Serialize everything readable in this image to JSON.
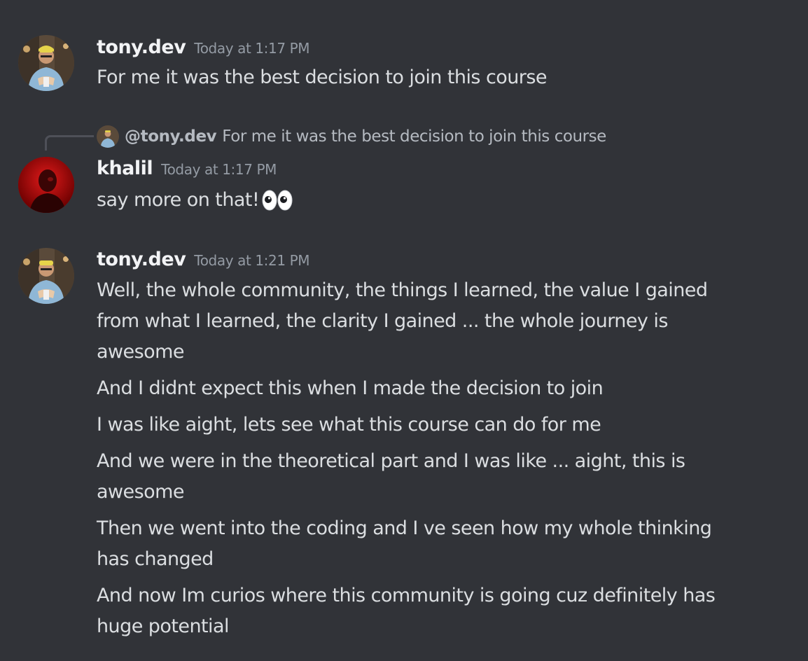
{
  "messages": [
    {
      "username": "tony.dev",
      "timestamp": "Today at 1:17 PM",
      "lines": [
        "For me it was the best decision to join this course"
      ]
    },
    {
      "reply_to": {
        "mention": "@tony.dev",
        "text": "For me it was the best decision to join this course"
      },
      "username": "khalil",
      "timestamp": "Today at 1:17 PM",
      "lines": [
        "say more on that!"
      ],
      "emoji": "eyes"
    },
    {
      "username": "tony.dev",
      "timestamp": "Today at 1:21 PM",
      "lines": [
        "Well, the whole community, the things I learned, the value I gained",
        "from what I learned, the clarity I gained ... the whole journey is",
        "awesome",
        "And I didnt expect this when I made the decision to join",
        "I was like aight, lets see what this course can do for me",
        "And we were in the theoretical part and I was like ... aight, this is",
        "awesome",
        "Then we went into the coding and I ve seen how my whole thinking",
        "has changed",
        "And now Im curios where this community is going cuz definitely has",
        "huge potential"
      ]
    }
  ],
  "colors": {
    "background": "#313338",
    "username": "#f2f3f5",
    "timestamp": "#949ba4",
    "text": "#dbdee1",
    "reply_text": "#b5bac1"
  }
}
